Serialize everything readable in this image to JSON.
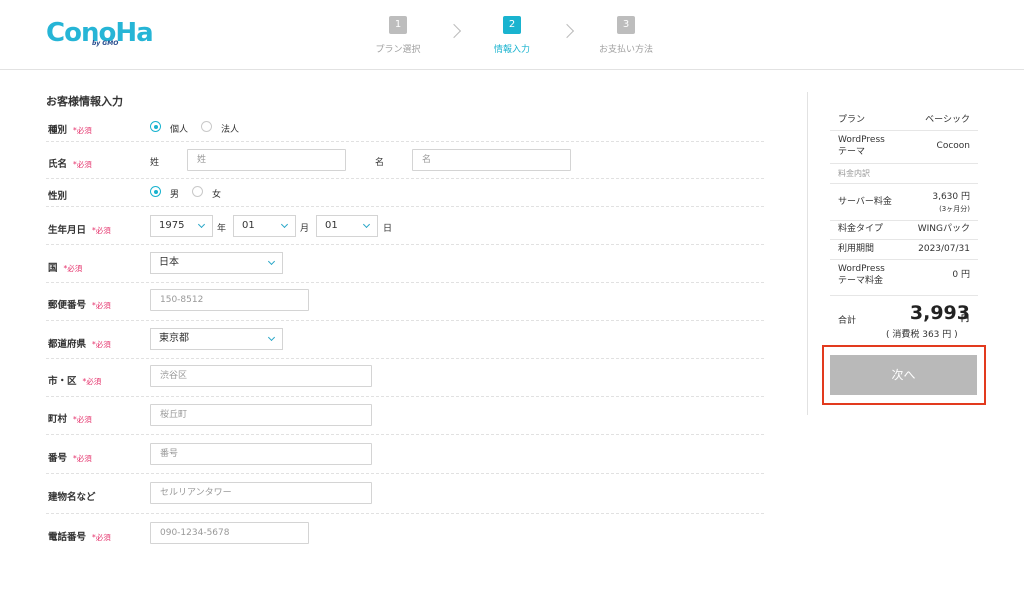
{
  "header": {
    "logo_text": "ConoHa",
    "logo_sub": "by GMO",
    "steps": [
      {
        "num": "1",
        "label": "プラン選択"
      },
      {
        "num": "2",
        "label": "情報入力"
      },
      {
        "num": "3",
        "label": "お支払い方法"
      }
    ],
    "active_step": 2
  },
  "form": {
    "title": "お客様情報入力",
    "required_mark": "*必須",
    "type": {
      "label": "種別",
      "options": [
        "個人",
        "法人"
      ],
      "selected": "個人"
    },
    "name": {
      "label": "氏名",
      "last_label": "姓",
      "last_placeholder": "姓",
      "first_label": "名",
      "first_placeholder": "名"
    },
    "gender": {
      "label": "性別",
      "options": [
        "男",
        "女"
      ],
      "selected": "男"
    },
    "birthdate": {
      "label": "生年月日",
      "year": "1975",
      "year_unit": "年",
      "month": "01",
      "month_unit": "月",
      "day": "01",
      "day_unit": "日"
    },
    "country": {
      "label": "国",
      "value": "日本"
    },
    "postal": {
      "label": "郵便番号",
      "placeholder": "150-8512"
    },
    "prefecture": {
      "label": "都道府県",
      "value": "東京都"
    },
    "city": {
      "label": "市・区",
      "placeholder": "渋谷区"
    },
    "town": {
      "label": "町村",
      "placeholder": "桜丘町"
    },
    "address_number": {
      "label": "番号",
      "placeholder": "番号"
    },
    "building": {
      "label": "建物名など",
      "placeholder": "セルリアンタワー"
    },
    "phone": {
      "label": "電話番号",
      "placeholder": "090-1234-5678"
    }
  },
  "summary": {
    "plan_label": "プラン",
    "plan_value": "ベーシック",
    "theme_label_1": "WordPress",
    "theme_label_2": "テーマ",
    "theme_value": "Cocoon",
    "breakdown_label": "料金内訳",
    "server_fee_label": "サーバー料金",
    "server_fee_value": "3,630 円",
    "server_fee_note": "(3ヶ月分)",
    "fee_type_label": "料金タイプ",
    "fee_type_value": "WINGパック",
    "period_label": "利用期間",
    "period_value": "2023/07/31",
    "theme_fee_label_1": "WordPress",
    "theme_fee_label_2": "テーマ料金",
    "theme_fee_value": "0 円",
    "total_label": "合計",
    "total_value": "3,993",
    "total_unit": "円",
    "tax_note": "( 消費税 363 円 )",
    "next_button": "次へ"
  },
  "colors": {
    "accent": "#19b3cf",
    "required": "#e5316b",
    "highlight": "#e23a1e",
    "button_disabled": "#b9b9b9"
  }
}
